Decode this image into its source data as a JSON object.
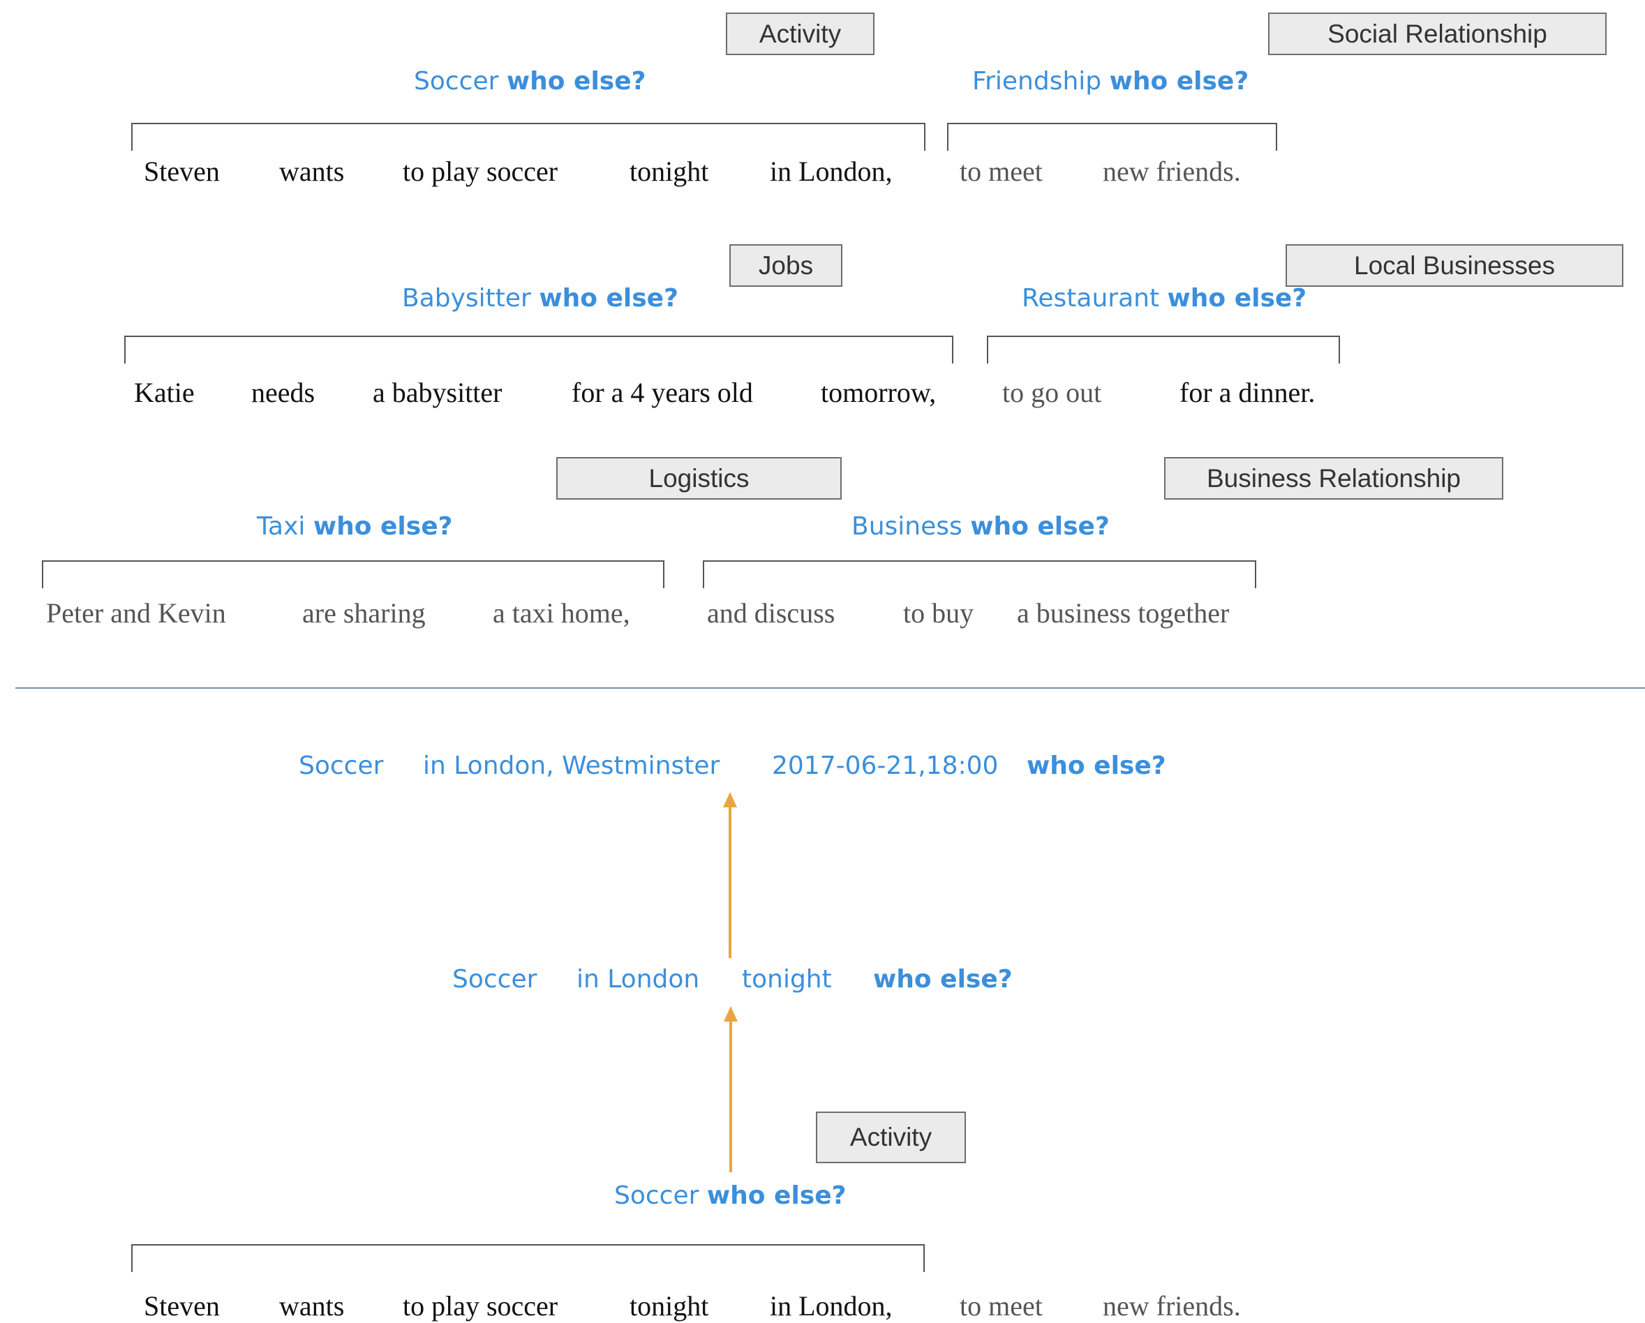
{
  "who_else": "who else?",
  "examples": [
    {
      "tags": [
        "Activity",
        "Social Relationship"
      ],
      "questions": [
        "Soccer",
        "Friendship"
      ],
      "words": [
        "Steven",
        "wants",
        "to play soccer",
        "tonight",
        "in London,",
        "to meet",
        "new friends."
      ]
    },
    {
      "tags": [
        "Jobs",
        "Local Businesses"
      ],
      "questions": [
        "Babysitter",
        "Restaurant"
      ],
      "words": [
        "Katie",
        "needs",
        "a babysitter",
        "for a 4 years old",
        "tomorrow,",
        "to go out",
        "for a dinner."
      ]
    },
    {
      "tags": [
        "Logistics",
        "Business Relationship"
      ],
      "questions": [
        "Taxi",
        "Business"
      ],
      "words": [
        "Peter and Kevin",
        "are sharing",
        "a taxi home,",
        "and discuss",
        "to buy",
        "a business together"
      ]
    }
  ],
  "refinement": {
    "top": [
      "Soccer",
      "in London, Westminster",
      "2017-06-21,18:00"
    ],
    "middle": [
      "Soccer",
      "in London",
      "tonight"
    ],
    "tag": "Activity",
    "question": "Soccer",
    "words": [
      "Steven",
      "wants",
      "to play soccer",
      "tonight",
      "in London,",
      "to meet",
      "new friends."
    ]
  },
  "colors": {
    "question_blue": "#3b8fdc",
    "arrow_orange": "#eba540",
    "tag_fill": "#ebebeb",
    "divider": "#6f90ad"
  }
}
